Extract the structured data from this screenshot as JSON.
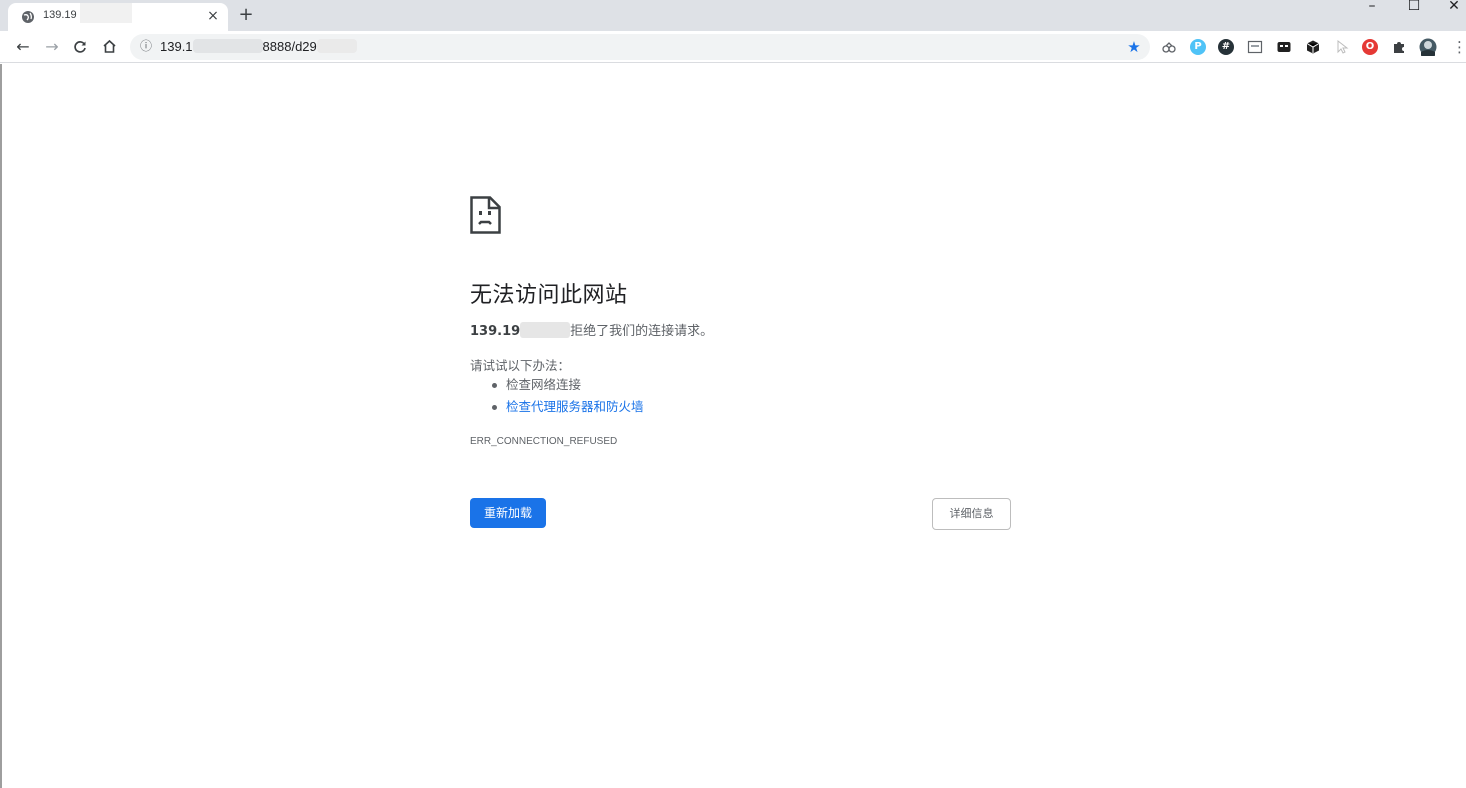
{
  "tab": {
    "title": "139.19",
    "favicon": "globe-icon",
    "close_glyph": "×",
    "new_tab_glyph": "+"
  },
  "window_controls": {
    "minimize": "–",
    "maximize": "☐",
    "close": "✕"
  },
  "toolbar": {
    "back_glyph": "←",
    "forward_glyph": "→",
    "reload_glyph": "C",
    "home_glyph": "⌂",
    "info_glyph": "ⓘ",
    "url_prefix": "139.1",
    "url_suffix": "8888/d29",
    "star_glyph": "★",
    "menu_glyph": "⋮"
  },
  "extensions": [
    {
      "name": "cloud-extension-icon",
      "glyph": "",
      "color": "#ffffff"
    },
    {
      "name": "p-extension-icon",
      "glyph": "P",
      "color": "#4fc3f7"
    },
    {
      "name": "hash-extension-icon",
      "glyph": "#",
      "color": "#263238"
    },
    {
      "name": "reader-extension-icon",
      "glyph": "",
      "color": "#ffffff"
    },
    {
      "name": "mask-extension-icon",
      "glyph": "",
      "color": "#212121"
    },
    {
      "name": "cube-extension-icon",
      "glyph": "",
      "color": "#212121"
    },
    {
      "name": "cursor-extension-icon",
      "glyph": "",
      "color": "#ffffff"
    },
    {
      "name": "opera-extension-icon",
      "glyph": "O",
      "color": "#e53935"
    },
    {
      "name": "puzzle-extension-icon",
      "glyph": "",
      "color": "#ffffff"
    },
    {
      "name": "profile-avatar-icon",
      "glyph": "",
      "color": "#ffffff"
    }
  ],
  "error": {
    "title": "无法访问此网站",
    "host": "139.19",
    "refused_text": "拒绝了我们的连接请求。",
    "suggest_title": "请试试以下办法：",
    "suggestions": [
      {
        "text": "检查网络连接",
        "link": false
      },
      {
        "text": "检查代理服务器和防火墙",
        "link": true
      }
    ],
    "code": "ERR_CONNECTION_REFUSED",
    "reload_label": "重新加载",
    "details_label": "详细信息"
  },
  "colors": {
    "accent": "#1a73e8",
    "tabstrip": "#dee1e6",
    "text_secondary": "#5f6368"
  }
}
